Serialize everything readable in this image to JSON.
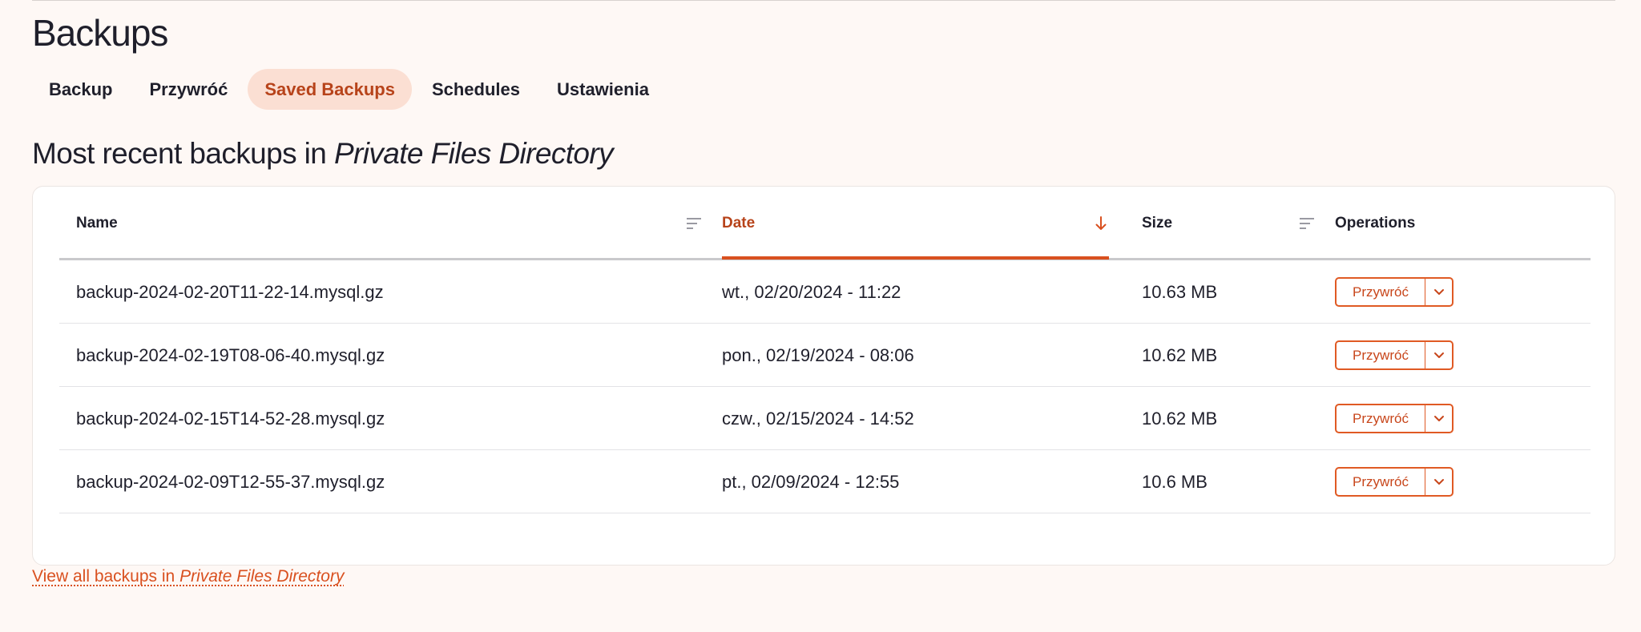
{
  "page": {
    "title": "Backups"
  },
  "tabs": [
    {
      "label": "Backup",
      "active": false
    },
    {
      "label": "Przywróć",
      "active": false
    },
    {
      "label": "Saved Backups",
      "active": true
    },
    {
      "label": "Schedules",
      "active": false
    },
    {
      "label": "Ustawienia",
      "active": false
    }
  ],
  "section": {
    "title_prefix": "Most recent backups in ",
    "title_location": "Private Files Directory"
  },
  "table": {
    "columns": {
      "name": "Name",
      "date": "Date",
      "size": "Size",
      "operations": "Operations"
    },
    "sorted_column": "date",
    "sort_direction": "descending",
    "rows": [
      {
        "name": "backup-2024-02-20T11-22-14.mysql.gz",
        "date": "wt., 02/20/2024 - 11:22",
        "size": "10.63 MB",
        "action": "Przywróć"
      },
      {
        "name": "backup-2024-02-19T08-06-40.mysql.gz",
        "date": "pon., 02/19/2024 - 08:06",
        "size": "10.62 MB",
        "action": "Przywróć"
      },
      {
        "name": "backup-2024-02-15T14-52-28.mysql.gz",
        "date": "czw., 02/15/2024 - 14:52",
        "size": "10.62 MB",
        "action": "Przywróć"
      },
      {
        "name": "backup-2024-02-09T12-55-37.mysql.gz",
        "date": "pt., 02/09/2024 - 12:55",
        "size": "10.6 MB",
        "action": "Przywróć"
      }
    ]
  },
  "footer_link": {
    "prefix": "View all backups in ",
    "location": "Private Files Directory"
  },
  "icons": {
    "sort": "sort-lines-icon",
    "sorted_desc": "arrow-down-icon",
    "dropdown": "chevron-down-icon"
  },
  "colors": {
    "accent": "#d9501f",
    "active_tab_bg": "#fbdfd3",
    "page_bg": "#fef8f5"
  }
}
